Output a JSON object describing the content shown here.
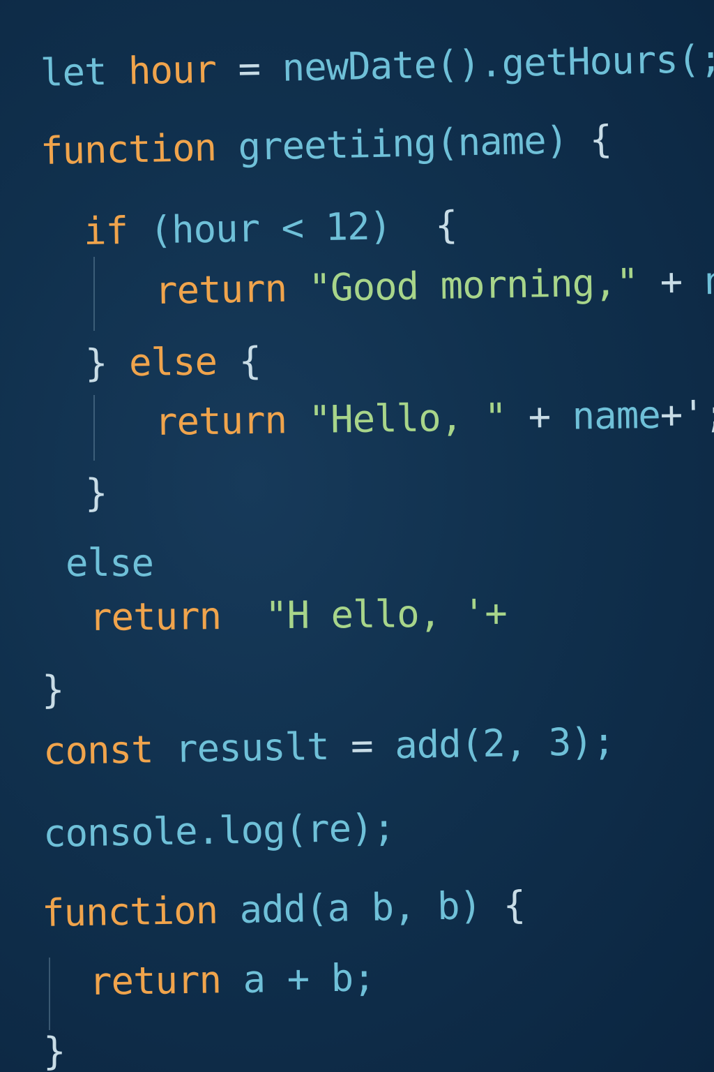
{
  "code": {
    "lines": [
      {
        "tokens": [
          {
            "text": "let ",
            "kind": "id"
          },
          {
            "text": "hour",
            "kind": "kw"
          },
          {
            "text": " = ",
            "kind": "pun"
          },
          {
            "text": "newDate().getHours(;",
            "kind": "id"
          }
        ]
      },
      {
        "tokens": [
          {
            "text": "function ",
            "kind": "kw"
          },
          {
            "text": "greetiing(name) ",
            "kind": "id"
          },
          {
            "text": "{",
            "kind": "pun"
          }
        ]
      },
      {
        "tokens": [
          {
            "text": "if ",
            "kind": "kw"
          },
          {
            "text": "(hour < 12)  ",
            "kind": "id"
          },
          {
            "text": "{",
            "kind": "pun"
          }
        ]
      },
      {
        "tokens": [
          {
            "text": "return ",
            "kind": "kw"
          },
          {
            "text": "\"Good morning,\"",
            "kind": "str"
          },
          {
            "text": " + ",
            "kind": "pun"
          },
          {
            "text": "name",
            "kind": "id"
          }
        ]
      },
      {
        "tokens": [
          {
            "text": "} ",
            "kind": "pun"
          },
          {
            "text": "else ",
            "kind": "kw"
          },
          {
            "text": "{",
            "kind": "pun"
          }
        ]
      },
      {
        "tokens": [
          {
            "text": "return ",
            "kind": "kw"
          },
          {
            "text": "\"Hello, \"",
            "kind": "str"
          },
          {
            "text": " + ",
            "kind": "pun"
          },
          {
            "text": "name",
            "kind": "id"
          },
          {
            "text": "+';",
            "kind": "pun"
          }
        ]
      },
      {
        "tokens": [
          {
            "text": "}",
            "kind": "pun"
          }
        ]
      },
      {
        "tokens": [
          {
            "text": "else",
            "kind": "id"
          }
        ]
      },
      {
        "tokens": [
          {
            "text": "return  ",
            "kind": "kw"
          },
          {
            "text": "\"H ello, '+",
            "kind": "str"
          }
        ]
      },
      {
        "tokens": [
          {
            "text": "}",
            "kind": "pun"
          }
        ]
      },
      {
        "tokens": [
          {
            "text": "const ",
            "kind": "kw"
          },
          {
            "text": "resuslt",
            "kind": "id"
          },
          {
            "text": " = ",
            "kind": "pun"
          },
          {
            "text": "add(2, 3);",
            "kind": "id"
          }
        ]
      },
      {
        "tokens": [
          {
            "text": "console.log(re);",
            "kind": "id"
          }
        ]
      },
      {
        "tokens": [
          {
            "text": "function ",
            "kind": "kw"
          },
          {
            "text": "add(a b, b) ",
            "kind": "id"
          },
          {
            "text": "{",
            "kind": "pun"
          }
        ]
      },
      {
        "tokens": [
          {
            "text": "return ",
            "kind": "kw"
          },
          {
            "text": "a + b;",
            "kind": "id"
          }
        ]
      },
      {
        "tokens": [
          {
            "text": "}",
            "kind": "pun"
          }
        ]
      }
    ]
  },
  "colors": {
    "background": "#10304d",
    "keyword": "#f0a44c",
    "identifier": "#6fc0d8",
    "string": "#a8d58a",
    "punctuation": "#c8dce6"
  }
}
